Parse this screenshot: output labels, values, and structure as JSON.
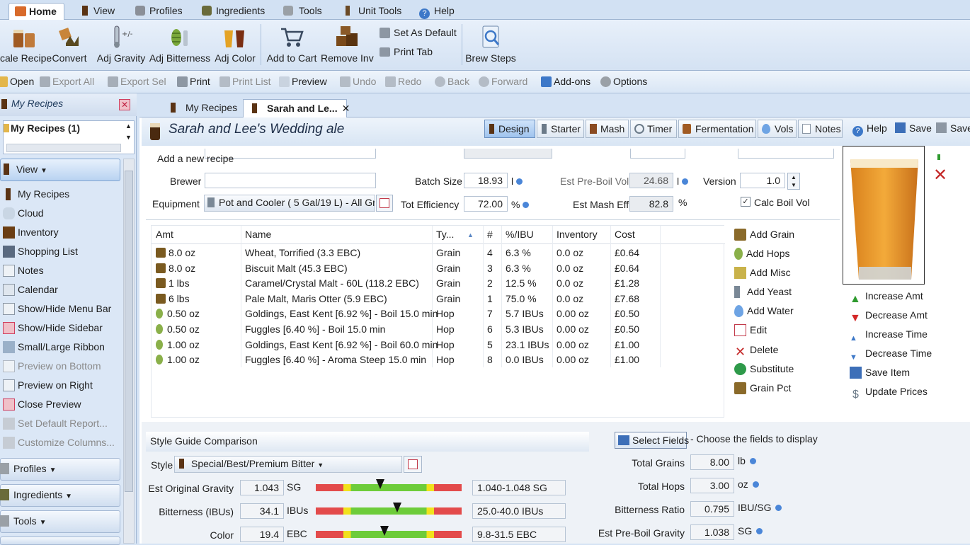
{
  "menu_tabs": [
    "Home",
    "View",
    "Profiles",
    "Ingredients",
    "Tools",
    "Unit Tools",
    "Help"
  ],
  "ribbon": {
    "scale_recipe": "cale Recipe",
    "convert": "Convert",
    "adj_gravity": "Adj Gravity",
    "adj_bitterness": "Adj Bitterness",
    "adj_color": "Adj Color",
    "add_to_cart": "Add to Cart",
    "remove_inv": "Remove Inv",
    "set_as_default": "Set As Default",
    "print_tab": "Print Tab",
    "brew_steps": "Brew Steps"
  },
  "quickbar": {
    "open": "Open",
    "export_all": "Export All",
    "export_sel": "Export Sel",
    "print": "Print",
    "print_list": "Print List",
    "preview": "Preview",
    "undo": "Undo",
    "redo": "Redo",
    "back": "Back",
    "forward": "Forward",
    "addons": "Add-ons",
    "options": "Options"
  },
  "sidebar": {
    "header": "My Recipes",
    "tree_root": "My Recipes (1)",
    "view_group": "View",
    "items": [
      "My Recipes",
      "Cloud",
      "Inventory",
      "Shopping List",
      "Notes",
      "Calendar",
      "Show/Hide Menu Bar",
      "Show/Hide Sidebar",
      "Small/Large Ribbon",
      "Preview on Bottom",
      "Preview on Right",
      "Close Preview",
      "Set Default Report...",
      "Customize Columns..."
    ],
    "groups": [
      "Profiles",
      "Ingredients",
      "Tools"
    ]
  },
  "doc_tabs": [
    "My Recipes",
    "Sarah and Le..."
  ],
  "recipe": {
    "title": "Sarah and Lee's Wedding ale",
    "add_new": "Add a new recipe",
    "brewer_label": "Brewer",
    "brewer": "",
    "equipment_label": "Equipment",
    "equipment": "Pot and Cooler ( 5 Gal/19 L) - All Grai",
    "batch_size_label": "Batch Size",
    "batch_size": "18.93",
    "batch_unit": "l",
    "efficiency_label": "Tot Efficiency",
    "efficiency": "72.00",
    "eff_unit": "%",
    "preboil_label": "Est Pre-Boil Vol",
    "preboil": "24.68",
    "preboil_unit": "l",
    "mash_eff_label": "Est Mash Eff",
    "mash_eff": "82.8",
    "mash_unit": "%",
    "version_label": "Version",
    "version": "1.0",
    "calc_boil": "Calc Boil Vol"
  },
  "view_buttons": [
    "Design",
    "Starter",
    "Mash",
    "Timer",
    "Fermentation",
    "Vols",
    "Notes"
  ],
  "top_actions": [
    "Help",
    "Save",
    "Save"
  ],
  "table": {
    "headers": [
      "Amt",
      "Name",
      "Ty...",
      "#",
      "%/IBU",
      "Inventory",
      "Cost"
    ],
    "rows": [
      [
        "8.0 oz",
        "Wheat, Torrified (3.3 EBC)",
        "Grain",
        "4",
        "6.3 %",
        "0.0 oz",
        "£0.64"
      ],
      [
        "8.0 oz",
        "Biscuit Malt (45.3 EBC)",
        "Grain",
        "3",
        "6.3 %",
        "0.0 oz",
        "£0.64"
      ],
      [
        "1 lbs",
        "Caramel/Crystal Malt - 60L (118.2 EBC)",
        "Grain",
        "2",
        "12.5 %",
        "0.0 oz",
        "£1.28"
      ],
      [
        "6 lbs",
        "Pale Malt, Maris Otter (5.9 EBC)",
        "Grain",
        "1",
        "75.0 %",
        "0.0 oz",
        "£7.68"
      ],
      [
        "0.50 oz",
        "Goldings, East Kent [6.92 %] - Boil 15.0 min",
        "Hop",
        "7",
        "5.7 IBUs",
        "0.00 oz",
        "£0.50"
      ],
      [
        "0.50 oz",
        "Fuggles [6.40 %] - Boil 15.0 min",
        "Hop",
        "6",
        "5.3 IBUs",
        "0.00 oz",
        "£0.50"
      ],
      [
        "1.00 oz",
        "Goldings, East Kent [6.92 %] - Boil 60.0 min",
        "Hop",
        "5",
        "23.1 IBUs",
        "0.00 oz",
        "£1.00"
      ],
      [
        "1.00 oz",
        "Fuggles [6.40 %] - Aroma Steep 15.0 min",
        "Hop",
        "8",
        "0.0 IBUs",
        "0.00 oz",
        "£1.00"
      ]
    ]
  },
  "add_actions": [
    "Add Grain",
    "Add Hops",
    "Add Misc",
    "Add Yeast",
    "Add Water",
    "Edit",
    "Delete",
    "Substitute",
    "Grain Pct"
  ],
  "amt_actions": [
    "Increase Amt",
    "Decrease Amt",
    "Increase Time",
    "Decrease Time",
    "Save Item",
    "Update Prices"
  ],
  "style": {
    "section": "Style Guide Comparison",
    "label": "Style",
    "value": "Special/Best/Premium Bitter",
    "rows": [
      {
        "label": "Est Original Gravity",
        "value": "1.043",
        "unit": "SG",
        "range": "1.040-1.048 SG",
        "pos": 0.44
      },
      {
        "label": "Bitterness (IBUs)",
        "value": "34.1",
        "unit": "IBUs",
        "range": "25.0-40.0 IBUs",
        "pos": 0.56
      },
      {
        "label": "Color",
        "value": "19.4",
        "unit": "EBC",
        "range": "9.8-31.5 EBC",
        "pos": 0.47
      }
    ]
  },
  "fields": {
    "button": "Select Fields",
    "hint": "- Choose the fields to display",
    "rows": [
      {
        "label": "Total Grains",
        "value": "8.00",
        "unit": "lb"
      },
      {
        "label": "Total Hops",
        "value": "3.00",
        "unit": "oz"
      },
      {
        "label": "Bitterness Ratio",
        "value": "0.795",
        "unit": "IBU/SG"
      },
      {
        "label": "Est Pre-Boil Gravity",
        "value": "1.038",
        "unit": "SG"
      }
    ]
  }
}
